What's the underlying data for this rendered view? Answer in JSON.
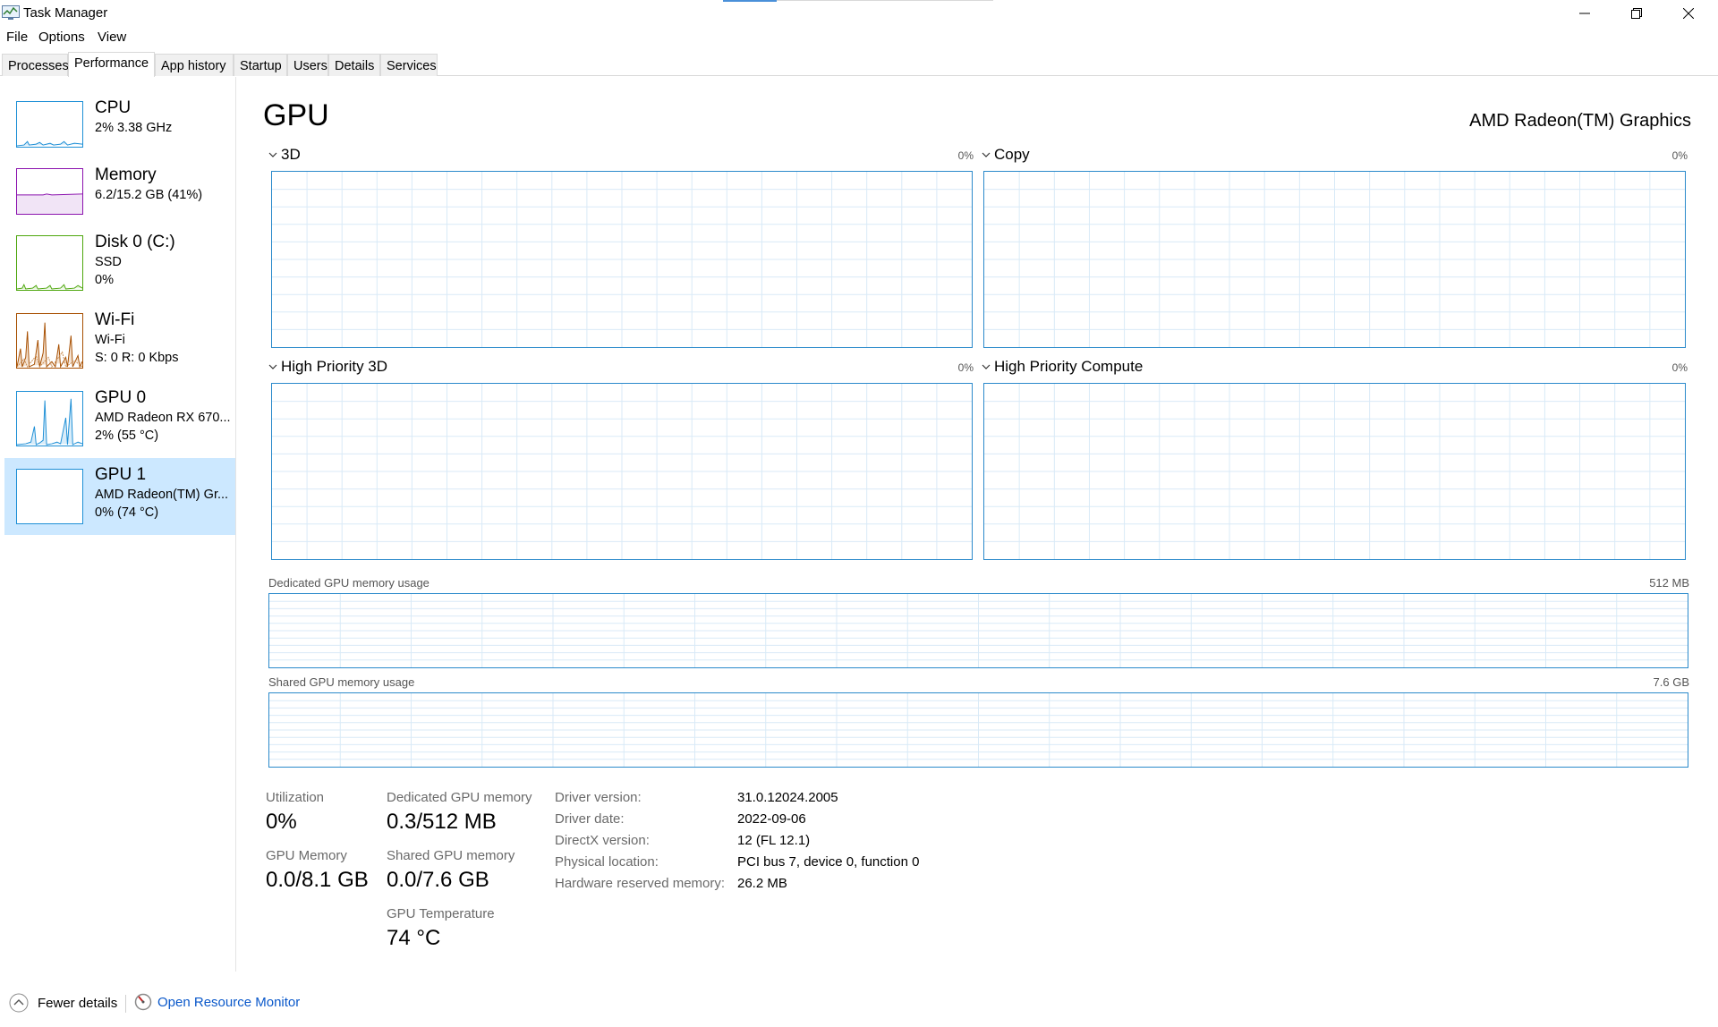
{
  "window": {
    "title": "Task Manager"
  },
  "menu": {
    "file": "File",
    "options": "Options",
    "view": "View"
  },
  "tabs": [
    {
      "label": "Processes"
    },
    {
      "label": "Performance"
    },
    {
      "label": "App history"
    },
    {
      "label": "Startup"
    },
    {
      "label": "Users"
    },
    {
      "label": "Details"
    },
    {
      "label": "Services"
    }
  ],
  "sidebar": {
    "items": [
      {
        "name": "CPU",
        "sub1": "2%  3.38 GHz",
        "sub2": "",
        "color": "#1d8fd6"
      },
      {
        "name": "Memory",
        "sub1": "6.2/15.2 GB (41%)",
        "sub2": "",
        "color": "#8b12ae"
      },
      {
        "name": "Disk 0 (C:)",
        "sub1": "SSD",
        "sub2": "0%",
        "color": "#4da60c"
      },
      {
        "name": "Wi-Fi",
        "sub1": "Wi-Fi",
        "sub2": "S: 0  R: 0 Kbps",
        "color": "#a74f01"
      },
      {
        "name": "GPU 0",
        "sub1": "AMD Radeon RX 670...",
        "sub2": "2%  (55 °C)",
        "color": "#1d8fd6"
      },
      {
        "name": "GPU 1",
        "sub1": "AMD Radeon(TM) Gr...",
        "sub2": "0%  (74 °C)",
        "color": "#1d8fd6"
      }
    ],
    "selected_index": 5
  },
  "main": {
    "title": "GPU",
    "device_name": "AMD Radeon(TM) Graphics",
    "engines": [
      {
        "label": "3D",
        "pct": "0%"
      },
      {
        "label": "Copy",
        "pct": "0%"
      },
      {
        "label": "High Priority 3D",
        "pct": "0%"
      },
      {
        "label": "High Priority Compute",
        "pct": "0%"
      }
    ],
    "dedicated_mem": {
      "label": "Dedicated GPU memory usage",
      "cap": "512 MB"
    },
    "shared_mem": {
      "label": "Shared GPU memory usage",
      "cap": "7.6 GB"
    },
    "stats": {
      "utilization_label": "Utilization",
      "utilization_value": "0%",
      "dedicated_label": "Dedicated GPU memory",
      "dedicated_value": "0.3/512 MB",
      "gpu_memory_label": "GPU Memory",
      "gpu_memory_value": "0.0/8.1 GB",
      "shared_label": "Shared GPU memory",
      "shared_value": "0.0/7.6 GB",
      "temp_label": "GPU Temperature",
      "temp_value": "74 °C"
    },
    "details": [
      {
        "label": "Driver version:",
        "value": "31.0.12024.2005"
      },
      {
        "label": "Driver date:",
        "value": "2022-09-06"
      },
      {
        "label": "DirectX version:",
        "value": "12 (FL 12.1)"
      },
      {
        "label": "Physical location:",
        "value": "PCI bus 7, device 0, function 0"
      },
      {
        "label": "Hardware reserved memory:",
        "value": "26.2 MB"
      }
    ]
  },
  "footer": {
    "fewer_details": "Fewer details",
    "open_resource_monitor": "Open Resource Monitor"
  },
  "colors": {
    "accent": "#2b8acb",
    "grid": "#d9eaf7",
    "selected_bg": "#cce8ff",
    "link": "#0a58ca"
  }
}
